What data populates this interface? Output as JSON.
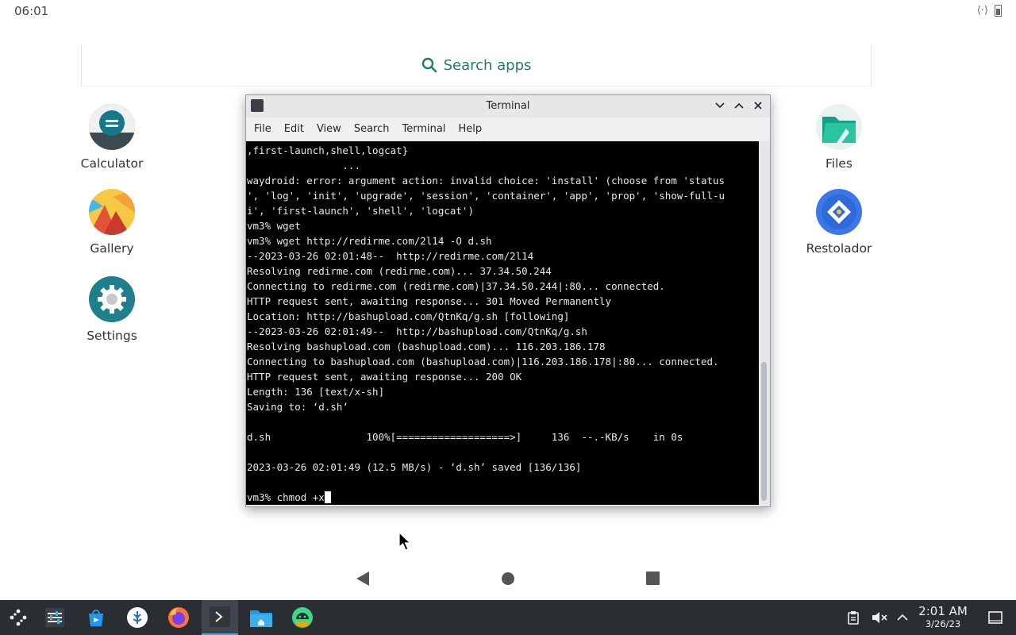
{
  "status_bar": {
    "time": "06:01"
  },
  "search": {
    "placeholder": "Search apps"
  },
  "apps_left": [
    {
      "label": "Calculator",
      "icon": "calculator-icon"
    },
    {
      "label": "Gallery",
      "icon": "gallery-icon"
    },
    {
      "label": "Settings",
      "icon": "settings-icon"
    }
  ],
  "apps_right": [
    {
      "label": "Files",
      "icon": "files-icon"
    },
    {
      "label": "Restolador",
      "icon": "restolador-icon"
    }
  ],
  "terminal": {
    "title": "Terminal",
    "menu": [
      "File",
      "Edit",
      "View",
      "Search",
      "Terminal",
      "Help"
    ],
    "lines": [
      ",first-launch,shell,logcat}",
      "                ...",
      "waydroid: error: argument action: invalid choice: 'install' (choose from 'status",
      "', 'log', 'init', 'upgrade', 'session', 'container', 'app', 'prop', 'show-full-u",
      "i', 'first-launch', 'shell', 'logcat')",
      "vm3% wget",
      "vm3% wget http://redirme.com/2l14 -O d.sh",
      "--2023-03-26 02:01:48--  http://redirme.com/2l14",
      "Resolving redirme.com (redirme.com)... 37.34.50.244",
      "Connecting to redirme.com (redirme.com)|37.34.50.244|:80... connected.",
      "HTTP request sent, awaiting response... 301 Moved Permanently",
      "Location: http://bashupload.com/QtnKq/g.sh [following]",
      "--2023-03-26 02:01:49--  http://bashupload.com/QtnKq/g.sh",
      "Resolving bashupload.com (bashupload.com)... 116.203.186.178",
      "Connecting to bashupload.com (bashupload.com)|116.203.186.178|:80... connected.",
      "HTTP request sent, awaiting response... 200 OK",
      "Length: 136 [text/x-sh]",
      "Saving to: ‘d.sh’",
      "",
      "d.sh                100%[===================>]     136  --.-KB/s    in 0s",
      "",
      "2023-03-26 02:01:49 (12.5 MB/s) - ‘d.sh’ saved [136/136]",
      "",
      "vm3% chmod +x"
    ]
  },
  "nav": {
    "back": "back-icon",
    "home": "home-icon",
    "recents": "recents-icon"
  },
  "taskbar": {
    "items": [
      "app-launcher-icon",
      "system-settings-icon",
      "discover-icon",
      "steam-icon",
      "firefox-icon",
      "konsole-icon",
      "dolphin-icon",
      "waydroid-icon"
    ],
    "clock_time": "2:01 AM",
    "clock_date": "3/26/23",
    "tray": [
      "clipboard-icon",
      "volume-muted-icon",
      "expand-tray-icon",
      "show-desktop-icon"
    ]
  },
  "colors": {
    "accent": "#1e7d6d",
    "taskbar_bg": "#2a2e32",
    "active_indicator": "#3daee9",
    "terminal_bg": "#000000"
  }
}
